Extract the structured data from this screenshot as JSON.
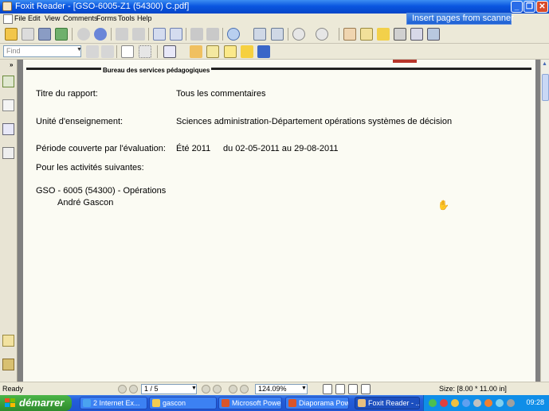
{
  "window": {
    "title": "Foxit Reader - [GSO-6005-Z1 (54300) C.pdf]",
    "min_glyph": "_",
    "max_glyph": "❐",
    "close_glyph": "✕"
  },
  "menu": {
    "items": [
      "File",
      "Edit",
      "View",
      "Comments",
      "Forms",
      "Tools",
      "Help"
    ],
    "banner": "Insert pages from scanner"
  },
  "toolbar2": {
    "find_placeholder": "Find"
  },
  "document": {
    "header": "Bureau des services pédagogiques",
    "rows": [
      {
        "label": "Titre du rapport:",
        "value": "Tous les commentaires"
      },
      {
        "label": "Unité d'enseignement:",
        "value": "Sciences administration-Département opérations systèmes de décision"
      },
      {
        "label": "Période couverte par l'évaluation:",
        "value": "Été 2011",
        "extra": "du 02-05-2011 au 29-08-2011"
      }
    ],
    "activities_label": "Pour les activités suivantes:",
    "course": "GSO - 6005 (54300) - Opérations",
    "instructor": "André Gascon"
  },
  "status": {
    "text": "Ready",
    "page": "1 / 5",
    "zoom": "124.09%",
    "size": "Size: [8.00 * 11.00 in]"
  },
  "taskbar": {
    "start": "démarrer",
    "tasks": [
      "2 Internet Ex...",
      "gascon",
      "Microsoft Powe...",
      "Diaporama Pow...",
      "Foxit Reader - ..."
    ],
    "clock": "09:28"
  },
  "colors": {
    "titlebar": "#0a56e0",
    "taskbar": "#245edb",
    "start": "#2e8b2c",
    "page_bg": "#fbfbf3"
  }
}
